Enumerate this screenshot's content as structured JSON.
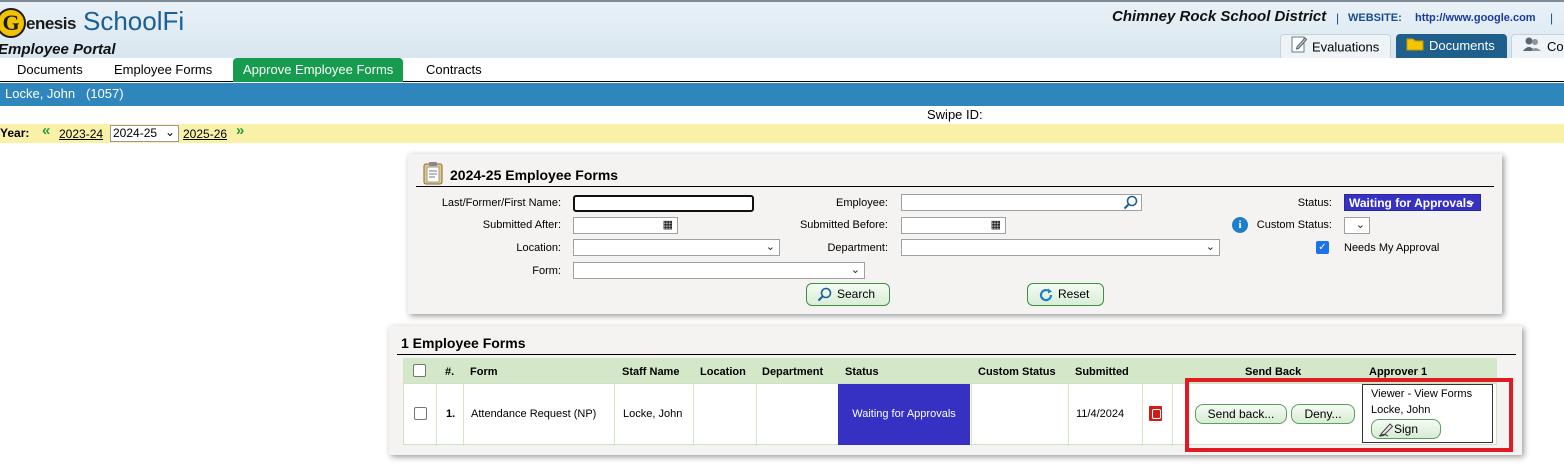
{
  "header": {
    "logo_letter": "G",
    "logo_text": "enesis",
    "app_name": "SchoolFi",
    "portal_title": "Employee Portal",
    "district": "Chimney Rock School District",
    "website_sep": "|",
    "website_label": "WEBSITE:",
    "website_url": "http://www.google.com",
    "website_sep2": "|",
    "tabs": [
      {
        "label": "Evaluations",
        "icon": "edit-document-icon",
        "active": false
      },
      {
        "label": "Documents",
        "icon": "folder-icon",
        "active": true
      },
      {
        "label": "Con",
        "icon": "people-icon",
        "active": false
      }
    ]
  },
  "nav": {
    "tabs": [
      {
        "label": "Documents",
        "active": false
      },
      {
        "label": "Employee Forms",
        "active": false
      },
      {
        "label": "Approve Employee Forms",
        "active": true
      },
      {
        "label": "Contracts",
        "active": false
      }
    ]
  },
  "user": {
    "name": "Locke, John",
    "id": "(1057)"
  },
  "swipe_id_label": "Swipe ID:",
  "year": {
    "label": "Year:",
    "prev_arrow": "«",
    "prev": "2023-24",
    "current": "2024-25",
    "next": "2025-26",
    "next_arrow": "»"
  },
  "search": {
    "title": "2024-25 Employee Forms",
    "name_label": "Last/Former/First Name:",
    "name_value": "",
    "employee_label": "Employee:",
    "employee_value": "",
    "status_label": "Status:",
    "status_value": "Waiting for Approvals",
    "submitted_after_label": "Submitted After:",
    "submitted_before_label": "Submitted Before:",
    "custom_status_label": "Custom Status:",
    "location_label": "Location:",
    "department_label": "Department:",
    "needs_approval_label": "Needs My Approval",
    "needs_approval_checked": true,
    "form_label": "Form:",
    "search_button": "Search",
    "reset_button": "Reset",
    "info_glyph": "i",
    "calendar_glyph": "▦",
    "dropdown_glyph": "⌄"
  },
  "results": {
    "title": "1 Employee Forms",
    "columns": [
      "#.",
      "Form",
      "Staff Name",
      "Location",
      "Department",
      "Status",
      "Custom Status",
      "Submitted",
      "Send Back",
      "Approver 1"
    ],
    "rows": [
      {
        "num": "1.",
        "form": "Attendance Request (NP)",
        "staff": "Locke, John",
        "location": "",
        "department": "",
        "status": "Waiting for Approvals",
        "custom_status": "",
        "submitted": "11/4/2024",
        "send_back_button": "Send back...",
        "deny_button": "Deny...",
        "approver_title": "Viewer - View Forms",
        "approver_name": "Locke, John",
        "sign_button": "Sign"
      }
    ]
  },
  "colors": {
    "header_blue": "#2f86bd",
    "nav_active": "#179b4f",
    "status_purple": "#3631c2",
    "highlight": "#e01b24",
    "year_bar": "#f8f1a7"
  }
}
